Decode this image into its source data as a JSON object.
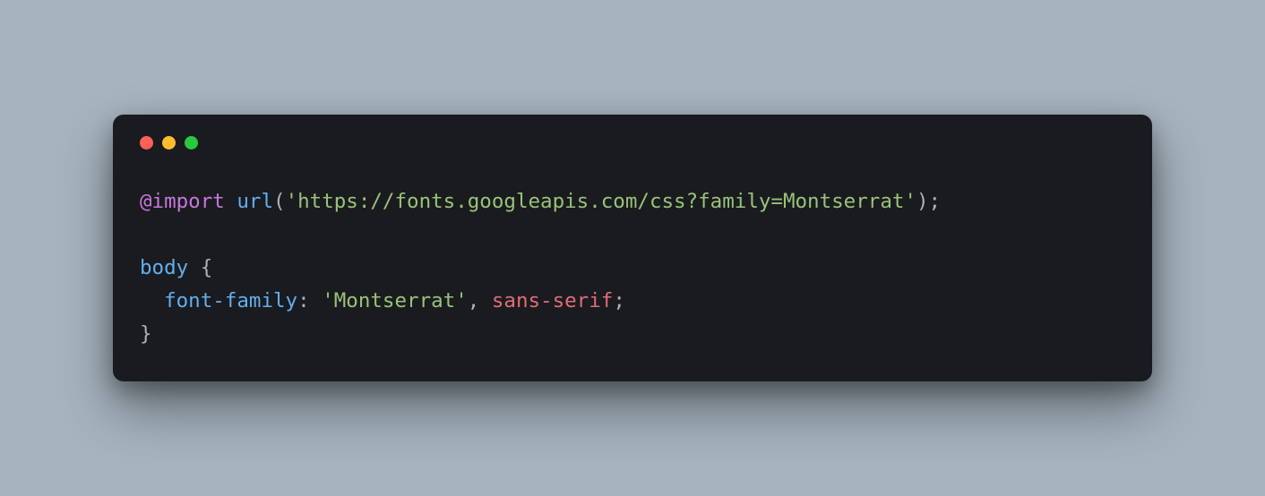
{
  "window": {
    "traffic_lights": [
      "close",
      "minimize",
      "zoom"
    ]
  },
  "code": {
    "line1": {
      "at_import": "@import",
      "fn": "url",
      "paren_open": "(",
      "quote1": "'",
      "url": "https://fonts.googleapis.com/css?family=Montserrat",
      "quote2": "'",
      "paren_close": ")",
      "semi": ";"
    },
    "blank": "",
    "line3": {
      "selector": "body",
      "brace_open": " {"
    },
    "line4": {
      "indent": "  ",
      "prop": "font-family",
      "colon": ": ",
      "val1_q1": "'",
      "val1": "Montserrat",
      "val1_q2": "'",
      "comma": ", ",
      "val2": "sans-serif",
      "semi": ";"
    },
    "line5": {
      "brace_close": "}"
    }
  }
}
